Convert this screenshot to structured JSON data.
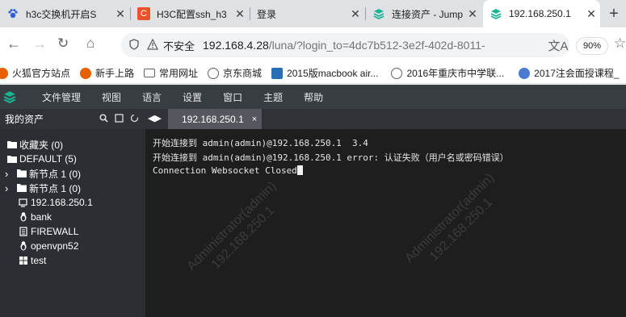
{
  "browser": {
    "tabs": [
      {
        "title": "h3c交换机开启S",
        "fav": "paw",
        "fav_color": "#3060d8"
      },
      {
        "title": "H3C配置ssh_h3",
        "fav": "C",
        "fav_color": "#e8532a"
      },
      {
        "title": "登录",
        "fav": "",
        "fav_color": ""
      },
      {
        "title": "连接资产 - Jump",
        "fav": "jump",
        "fav_color": "#1ab394"
      },
      {
        "title": "192.168.250.1",
        "fav": "jump",
        "fav_color": "#1ab394"
      }
    ],
    "insecure_label": "不安全",
    "url_host": "192.168.4.28",
    "url_path": "/luna/?login_to=4dc7b512-3e2f-402d-8011-",
    "zoom": "90%",
    "bookmarks": [
      "火狐官方站点",
      "新手上路",
      "常用网址",
      "京东商城",
      "2015版macbook air...",
      "2016年重庆市中学联...",
      "2017注会面授课程_"
    ]
  },
  "app": {
    "menu": [
      "文件管理",
      "视图",
      "语言",
      "设置",
      "窗口",
      "主题",
      "帮助"
    ],
    "sidebar_title": "我的资产",
    "session_tab": "192.168.250.1",
    "tree": [
      {
        "label": "收藏夹 (0)",
        "icon": "folder-open-icon",
        "arrow": ""
      },
      {
        "label": "DEFAULT (5)",
        "icon": "folder-open-icon",
        "arrow": ""
      },
      {
        "label": "新节点 1 (0)",
        "icon": "folder-icon",
        "arrow": "›"
      },
      {
        "label": "新节点 1 (0)",
        "icon": "folder-icon",
        "arrow": "›"
      },
      {
        "label": "192.168.250.1",
        "icon": "server-icon",
        "arrow": ""
      },
      {
        "label": "bank",
        "icon": "linux-icon",
        "arrow": ""
      },
      {
        "label": "FIREWALL",
        "icon": "doc-icon",
        "arrow": ""
      },
      {
        "label": "openvpn52",
        "icon": "linux-icon",
        "arrow": ""
      },
      {
        "label": "test",
        "icon": "windows-icon",
        "arrow": ""
      }
    ],
    "terminal_lines": [
      "开始连接到 admin(admin)@192.168.250.1  3.4",
      "开始连接到 admin(admin)@192.168.250.1 error: 认证失败（用户名或密码错误）",
      "Connection Websocket Closed"
    ],
    "watermark": [
      "Administrator(admin)",
      "192.168.250.1"
    ]
  }
}
